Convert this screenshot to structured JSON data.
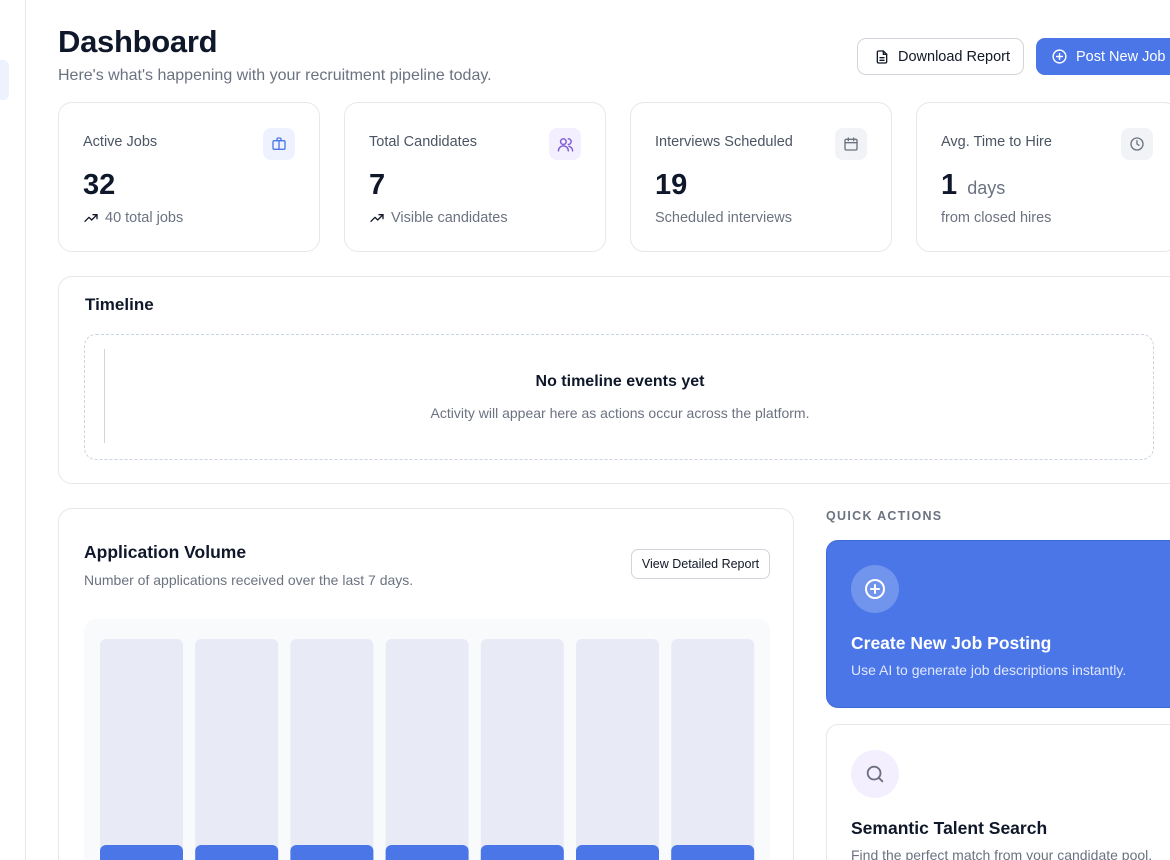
{
  "header": {
    "title": "Dashboard",
    "subtitle": "Here's what's happening with your recruitment pipeline today.",
    "download_label": "Download Report",
    "post_job_label": "Post New Job"
  },
  "stats": [
    {
      "label": "Active Jobs",
      "value": "32",
      "unit": "",
      "sub": "40 total jobs",
      "icon": "briefcase-icon",
      "trend": true
    },
    {
      "label": "Total Candidates",
      "value": "7",
      "unit": "",
      "sub": "Visible candidates",
      "icon": "users-icon",
      "trend": true
    },
    {
      "label": "Interviews Scheduled",
      "value": "19",
      "unit": "",
      "sub": "Scheduled interviews",
      "icon": "calendar-icon",
      "trend": false
    },
    {
      "label": "Avg. Time to Hire",
      "value": "1",
      "unit": "days",
      "sub": "from closed hires",
      "icon": "clock-icon",
      "trend": false
    }
  ],
  "timeline": {
    "title": "Timeline",
    "empty_title": "No timeline events yet",
    "empty_sub": "Activity will appear here as actions occur across the platform."
  },
  "chart": {
    "title": "Application Volume",
    "subtitle": "Number of applications received over the last 7 days.",
    "button_label": "View Detailed Report"
  },
  "quick_actions": {
    "heading": "QUICK ACTIONS",
    "items": [
      {
        "title": "Create New Job Posting",
        "sub": "Use AI to generate job descriptions instantly.",
        "icon": "plus-circle-icon"
      },
      {
        "title": "Semantic Talent Search",
        "sub": "Find the perfect match from your candidate pool.",
        "icon": "search-icon"
      }
    ]
  },
  "colors": {
    "primary": "#4a76e8",
    "bar_track": "#e8ebf6",
    "bar_fill": "#4a76e8"
  }
}
